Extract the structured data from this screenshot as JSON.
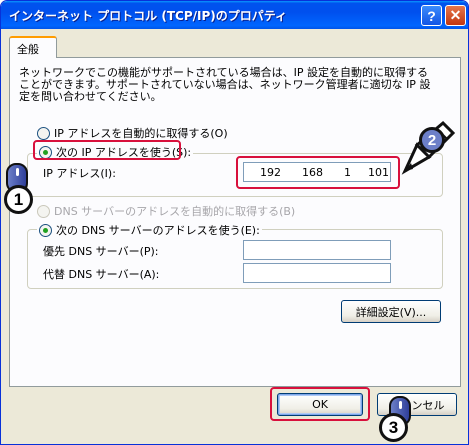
{
  "window": {
    "title": "インターネット プロトコル (TCP/IP)のプロパティ",
    "help_label": "?",
    "close_label": "✕"
  },
  "tab": {
    "label": "全般"
  },
  "description": [
    "ネットワークでこの機能がサポートされている場合は、IP 設定を自動的に取得する",
    "ことができます。サポートされていない場合は、ネットワーク管理者に適切な IP 設",
    "定を問い合わせてください。"
  ],
  "ip_options": {
    "auto_label": "IP アドレスを自動的に取得する(O)",
    "manual_label": "次の IP アドレスを使う(S):",
    "selected": "manual"
  },
  "ip_address": {
    "label": "IP アドレス(I):",
    "octets": [
      "192",
      "168",
      "1",
      "101"
    ]
  },
  "dns_options": {
    "auto_label": "DNS サーバーのアドレスを自動的に取得する(B)",
    "manual_label": "次の DNS サーバーのアドレスを使う(E):",
    "selected": "manual"
  },
  "dns_fields": {
    "preferred_label": "優先 DNS サーバー(P):",
    "preferred_value": "",
    "alternate_label": "代替 DNS サーバー(A):",
    "alternate_value": ""
  },
  "buttons": {
    "advanced": "詳細設定(V)...",
    "ok": "OK",
    "cancel": "キャンセル"
  },
  "annotations": {
    "step1": "1",
    "step2": "2",
    "step3": "3",
    "highlight_color": "#d8103c"
  },
  "colors": {
    "titlebar": "#0055e8",
    "radio_dot": "#21a121",
    "dialog_bg": "#ece9d8"
  }
}
